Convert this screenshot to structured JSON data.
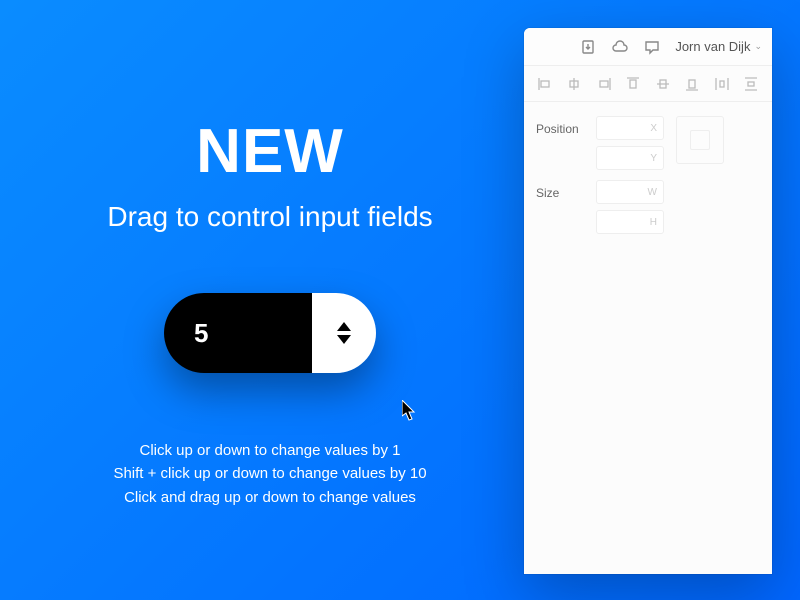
{
  "hero": {
    "title": "NEW",
    "subtitle": "Drag to control input fields",
    "stepper_value": "5",
    "hint1": "Click up or down to change values by 1",
    "hint2": "Shift + click up or down to change values by 10",
    "hint3": "Click and drag up or down to change values"
  },
  "titlebar": {
    "user_name": "Jorn van Dijk"
  },
  "inspector": {
    "position_label": "Position",
    "size_label": "Size",
    "x_suffix": "X",
    "y_suffix": "Y",
    "w_suffix": "W",
    "h_suffix": "H"
  }
}
